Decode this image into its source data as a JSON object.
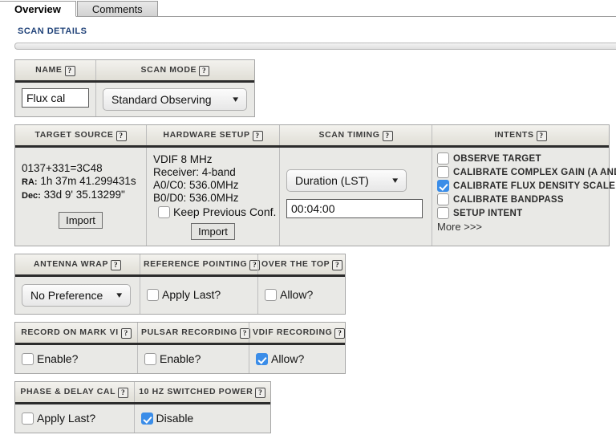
{
  "tabs": [
    {
      "label": "Overview",
      "active": true
    },
    {
      "label": "Comments",
      "active": false
    }
  ],
  "section": {
    "title": "SCAN DETAILS"
  },
  "help_glyph": "?",
  "name_panel": {
    "headers": {
      "name": "NAME",
      "scan_mode": "SCAN MODE"
    },
    "name_value": "Flux cal",
    "name_placeholder": "",
    "scan_mode_value": "Standard Observing",
    "chevron": "⌄"
  },
  "main_panel": {
    "headers": {
      "target_source": "TARGET SOURCE",
      "hardware_setup": "HARDWARE SETUP",
      "scan_timing": "SCAN TIMING",
      "intents": "INTENTS"
    },
    "target_source": {
      "source_name": "0137+331=3C48",
      "ra_label": "RA:",
      "ra_value": "1h 37m 41.299431s",
      "dec_label": "Dec:",
      "dec_value": "33d 9' 35.13299\"",
      "import_label": "Import"
    },
    "hardware_setup": {
      "lines": [
        "VDIF 8 MHz",
        "Receiver: 4-band",
        "A0/C0: 536.0MHz",
        "B0/D0: 536.0MHz"
      ],
      "keep_previous_label": "Keep Previous Conf.",
      "keep_previous_checked": false,
      "import_label": "Import"
    },
    "scan_timing": {
      "mode_value": "Duration (LST)",
      "duration_value": "00:04:00"
    },
    "intents": {
      "items": [
        {
          "label": "OBSERVE TARGET",
          "checked": false
        },
        {
          "label": "CALIBRATE COMPLEX GAIN (A AND P)",
          "checked": false
        },
        {
          "label": "CALIBRATE FLUX DENSITY SCALE",
          "checked": true
        },
        {
          "label": "CALIBRATE BANDPASS",
          "checked": false
        },
        {
          "label": "SETUP INTENT",
          "checked": false
        }
      ],
      "more_label": "More >>>"
    }
  },
  "wrap_panel": {
    "headers": {
      "antenna_wrap": "ANTENNA WRAP",
      "reference_pointing": "REFERENCE POINTING",
      "over_the_top": "OVER THE TOP"
    },
    "antenna_wrap_value": "No Preference",
    "reference_pointing": {
      "label": "Apply Last?",
      "checked": false
    },
    "over_the_top": {
      "label": "Allow?",
      "checked": false
    }
  },
  "record_panel": {
    "headers": {
      "record_on_mark_vi": "RECORD ON MARK VI",
      "pulsar_recording": "PULSAR RECORDING",
      "vdif_recording": "VDIF RECORDING"
    },
    "record_on_mark_vi": {
      "label": "Enable?",
      "checked": false
    },
    "pulsar_recording": {
      "label": "Enable?",
      "checked": false
    },
    "vdif_recording": {
      "label": "Allow?",
      "checked": true
    }
  },
  "phase_panel": {
    "headers": {
      "phase_delay_cal": "PHASE & DELAY CAL",
      "switched_power": "10 Hz SWITCHED POWER"
    },
    "phase_delay_cal": {
      "label": "Apply Last?",
      "checked": false
    },
    "switched_power": {
      "label": "Disable",
      "checked": true
    }
  },
  "colors": {
    "accent_blue": "#3b8de8",
    "heading_blue": "#22447a",
    "panel_bg": "#e9e9e6"
  }
}
